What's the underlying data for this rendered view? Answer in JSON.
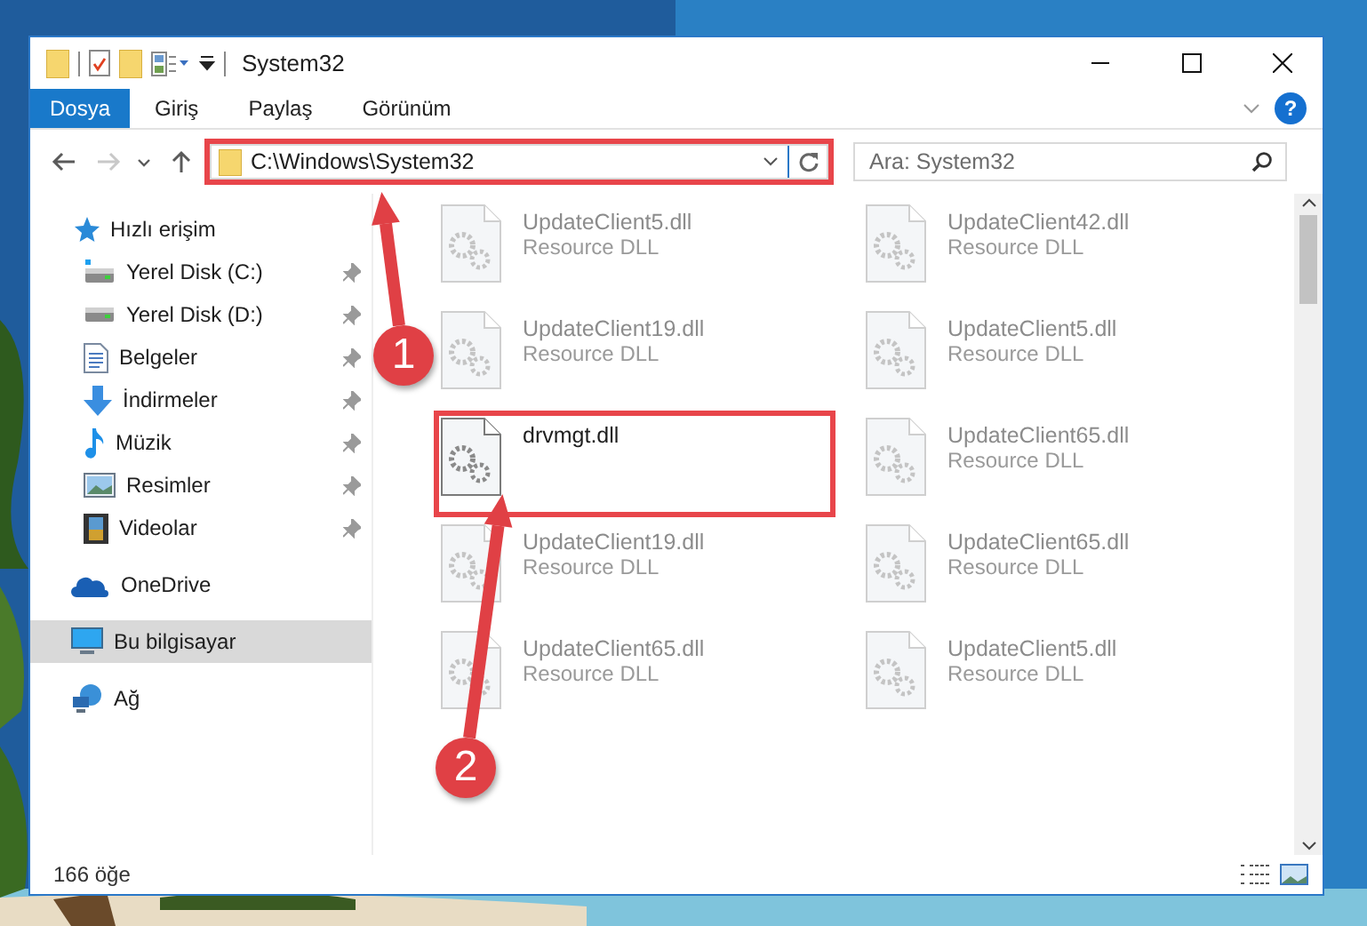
{
  "window": {
    "title": "System32",
    "help_label": "?"
  },
  "ribbon_tabs": [
    {
      "label": "Dosya",
      "selected": true
    },
    {
      "label": "Giriş",
      "selected": false
    },
    {
      "label": "Paylaş",
      "selected": false
    },
    {
      "label": "Görünüm",
      "selected": false
    }
  ],
  "nav_buttons": [
    {
      "kind": "back",
      "disabled": false
    },
    {
      "kind": "forward",
      "disabled": true
    },
    {
      "kind": "recent",
      "disabled": false
    },
    {
      "kind": "up",
      "disabled": false
    }
  ],
  "address_bar": {
    "path": "C:\\Windows\\System32",
    "highlighted": true
  },
  "search": {
    "placeholder": "Ara: System32"
  },
  "sidebar": {
    "items": [
      {
        "label": "Hızlı erişim",
        "kind": "star",
        "selected": false,
        "children": [
          {
            "label": "Yerel Disk (C:)",
            "kind": "system-drive",
            "pinned": true,
            "selected": false
          },
          {
            "label": "Yerel Disk (D:)",
            "kind": "drive",
            "pinned": true,
            "selected": false
          },
          {
            "label": "Belgeler",
            "kind": "document",
            "pinned": true,
            "selected": false
          },
          {
            "label": "İndirmeler",
            "kind": "download",
            "pinned": true,
            "selected": false
          },
          {
            "label": "Müzik",
            "kind": "music",
            "pinned": true,
            "selected": false
          },
          {
            "label": "Resimler",
            "kind": "pictures",
            "pinned": true,
            "selected": false
          },
          {
            "label": "Videolar",
            "kind": "videos",
            "pinned": true,
            "selected": false
          }
        ]
      },
      {
        "label": "OneDrive",
        "kind": "cloud",
        "selected": false
      },
      {
        "label": "Bu bilgisayar",
        "kind": "computer",
        "selected": true
      },
      {
        "label": "Ağ",
        "kind": "network",
        "selected": false
      }
    ]
  },
  "files": [
    {
      "name": "UpdateClient5.dll",
      "type": "Resource DLL",
      "faded": true,
      "highlighted": false
    },
    {
      "name": "UpdateClient42.dll",
      "type": "Resource DLL",
      "faded": true,
      "highlighted": false
    },
    {
      "name": "UpdateClient19.dll",
      "type": "Resource DLL",
      "faded": true,
      "highlighted": false
    },
    {
      "name": "UpdateClient5.dll",
      "type": "Resource DLL",
      "faded": true,
      "highlighted": false
    },
    {
      "name": "drvmgt.dll",
      "faded": false,
      "highlighted": true
    },
    {
      "name": "UpdateClient65.dll",
      "type": "Resource DLL",
      "faded": true,
      "highlighted": false
    },
    {
      "name": "UpdateClient19.dll",
      "type": "Resource DLL",
      "faded": true,
      "highlighted": false
    },
    {
      "name": "UpdateClient65.dll",
      "type": "Resource DLL",
      "faded": true,
      "highlighted": false
    },
    {
      "name": "UpdateClient65.dll",
      "type": "Resource DLL",
      "faded": true,
      "highlighted": false
    },
    {
      "name": "UpdateClient5.dll",
      "type": "Resource DLL",
      "faded": true,
      "highlighted": false
    }
  ],
  "status_bar": {
    "item_count": "166 öğe"
  },
  "annotations": [
    {
      "label": "1"
    },
    {
      "label": "2"
    }
  ]
}
